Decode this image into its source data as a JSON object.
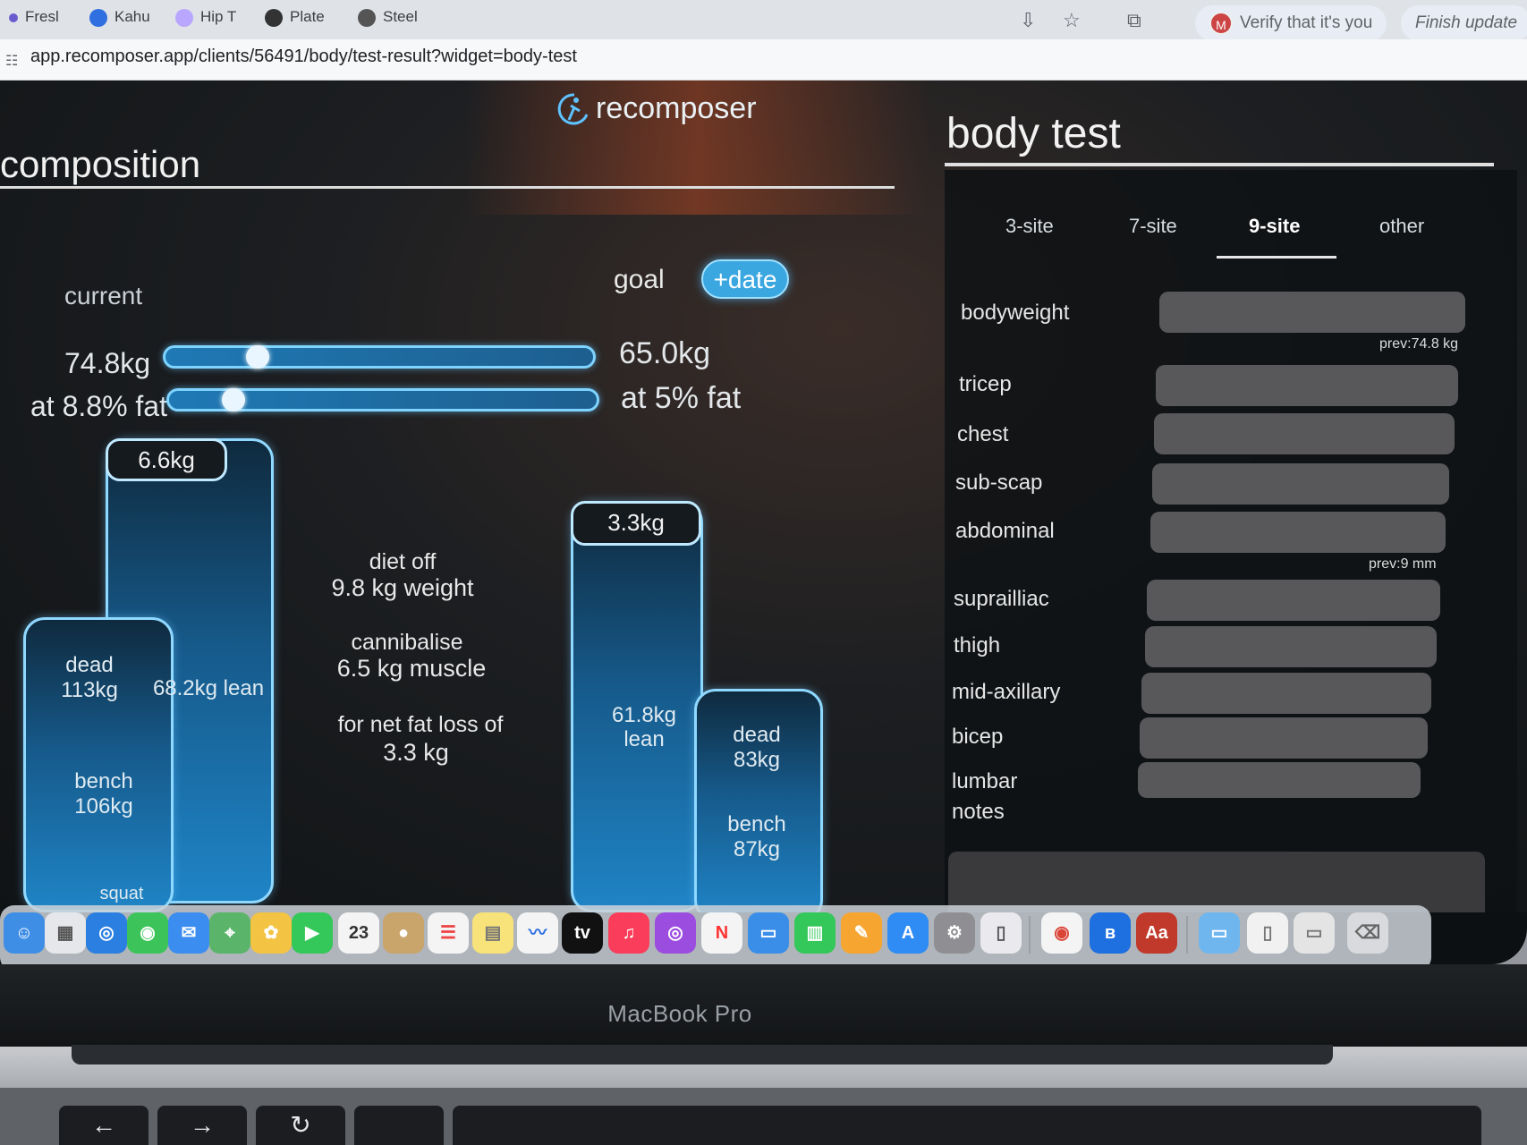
{
  "browser": {
    "tabs": [
      "Fresl",
      "Kahu",
      "Hip T",
      "Plate",
      "Steel"
    ],
    "url": "app.recomposer.app/clients/56491/body/test-result?widget=body-test",
    "verify_pill": "Verify that it's you",
    "update_pill": "Finish update"
  },
  "app": {
    "brand": "recomposer",
    "left_title": "composition",
    "current_label": "current",
    "goal_label": "goal",
    "date_button": "+date",
    "current_weight": "74.8kg",
    "current_fat": "at 8.8% fat",
    "goal_weight": "65.0kg",
    "goal_fat": "at 5% fat",
    "weight_slider_value": 0.2,
    "fat_slider_value": 0.13,
    "current_bars": {
      "fat_tag": "6.6kg",
      "lean_text": "68.2kg lean",
      "dead_label": "dead",
      "dead_value": "113kg",
      "bench_label": "bench",
      "bench_value": "106kg",
      "squat_label": "squat"
    },
    "middle": {
      "line1a": "diet off",
      "line1b": "9.8 kg weight",
      "line2a": "cannibalise",
      "line2b": "6.5 kg muscle",
      "line3a": "for net fat loss of",
      "line3b": "3.3 kg"
    },
    "goal_bars": {
      "fat_tag": "3.3kg",
      "lean_text": "61.8kg lean",
      "dead_label": "dead",
      "dead_value": "83kg",
      "bench_label": "bench",
      "bench_value": "87kg"
    }
  },
  "body_test": {
    "title": "body test",
    "tabs": [
      "3-site",
      "7-site",
      "9-site",
      "other"
    ],
    "active_tab": "9-site",
    "fields": [
      "bodyweight",
      "tricep",
      "chest",
      "sub-scap",
      "abdominal",
      "suprailliac",
      "thigh",
      "mid-axillary",
      "bicep",
      "lumbar"
    ],
    "prev_bodyweight": "prev:74.8 kg",
    "prev_abdominal": "prev:9 mm",
    "notes_label": "notes"
  },
  "laptop": {
    "label": "MacBook Pro",
    "dock_calendar_day": "23",
    "dock_tv": "tv",
    "dock_dict": "Aa"
  }
}
